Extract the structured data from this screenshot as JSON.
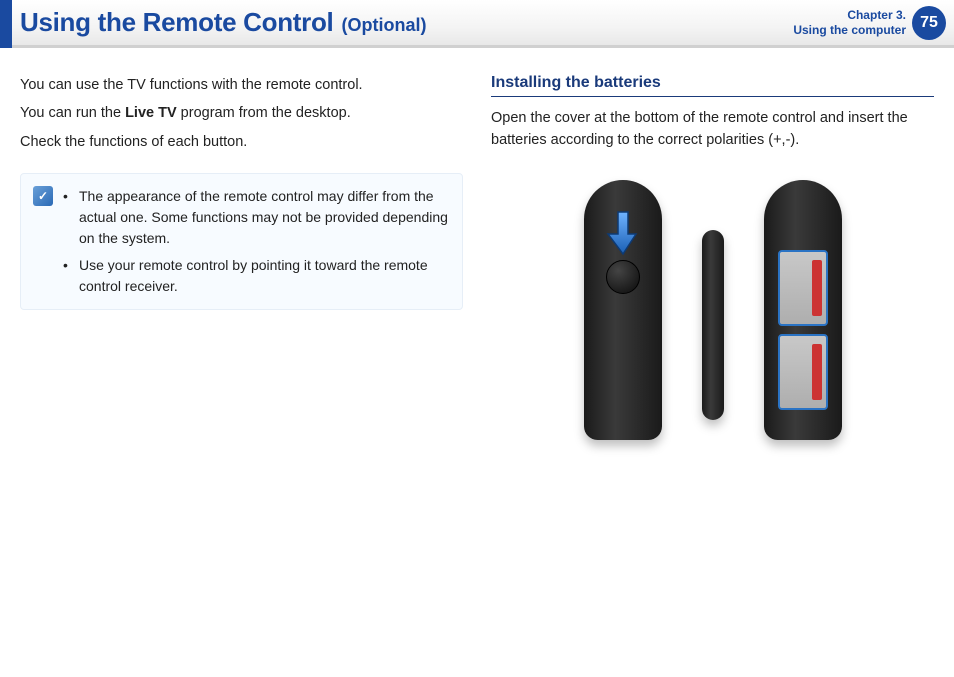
{
  "header": {
    "title_main": "Using the Remote Control",
    "title_sub": "(Optional)",
    "chapter_line1": "Chapter 3.",
    "chapter_line2": "Using the computer",
    "page_number": "75"
  },
  "left_column": {
    "para1": "You can use the TV functions with the remote control.",
    "para2_prefix": "You can run the ",
    "para2_bold": "Live TV",
    "para2_suffix": " program from the desktop.",
    "para3": "Check the functions of each button."
  },
  "note": {
    "bullets": [
      "The appearance of the remote control may differ from the actual one. Some functions may not be provided depending on the system.",
      "Use your remote control by pointing it toward the remote control receiver."
    ]
  },
  "right_column": {
    "heading": "Installing the batteries",
    "para": "Open the cover at the bottom of the remote control and insert the batteries according to the correct polarities (+,-)."
  }
}
